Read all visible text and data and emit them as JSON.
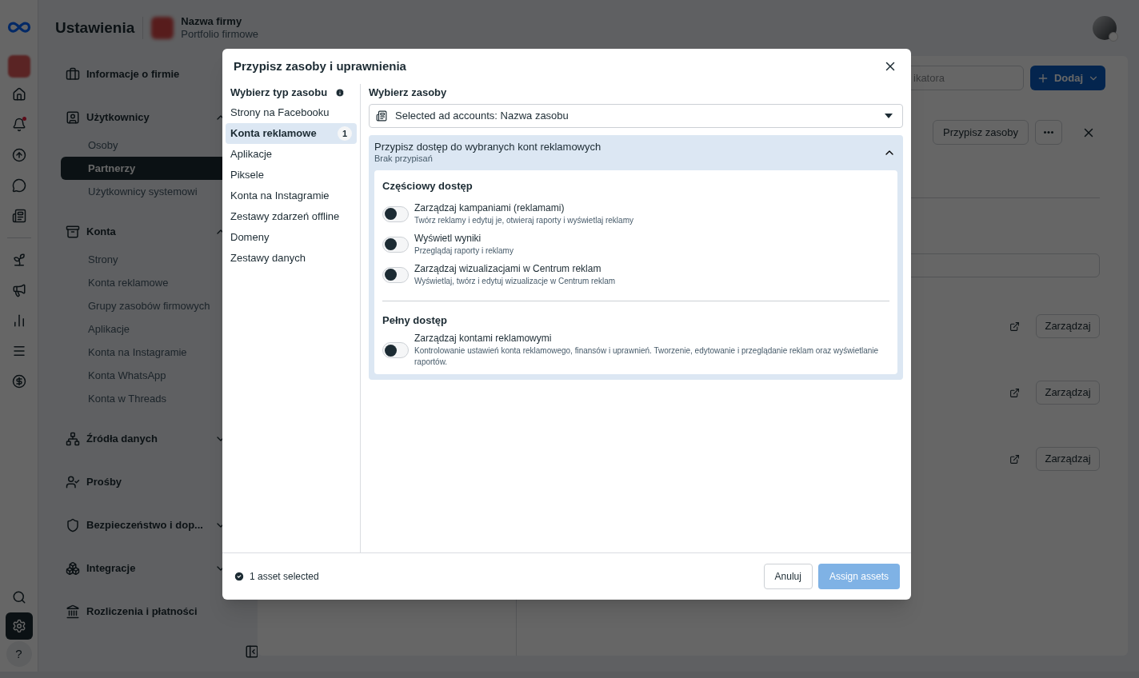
{
  "header": {
    "title": "Ustawienia",
    "business_name": "Nazwa firmy",
    "business_subtitle": "Portfolio firmowe"
  },
  "rail": {
    "top": [
      {
        "kind": "business",
        "selected": false
      },
      {
        "kind": "home",
        "selected": false
      },
      {
        "kind": "bell",
        "selected": false,
        "notification": true
      },
      {
        "kind": "navigation",
        "selected": false
      },
      {
        "kind": "chat",
        "selected": false
      },
      {
        "kind": "news",
        "selected": false
      }
    ],
    "middle": [
      {
        "kind": "sprout",
        "selected": false
      },
      {
        "kind": "megaphone",
        "selected": false
      },
      {
        "kind": "chart",
        "selected": false
      },
      {
        "kind": "menu",
        "selected": false
      },
      {
        "kind": "dollar",
        "selected": false
      }
    ],
    "bottom": [
      {
        "kind": "search",
        "selected": false
      },
      {
        "kind": "settings",
        "selected": true
      },
      {
        "kind": "help",
        "selected": false,
        "glyph": "?"
      }
    ]
  },
  "sidebar": {
    "sections": [
      {
        "kind": "link",
        "label": "Informacje o firmie"
      },
      {
        "kind": "group",
        "label": "Użytkownicy",
        "expanded": true,
        "items": [
          {
            "label": "Osoby",
            "selected": false
          },
          {
            "label": "Partnerzy",
            "selected": true
          },
          {
            "label": "Użytkownicy systemowi",
            "selected": false
          }
        ]
      },
      {
        "kind": "group",
        "label": "Konta",
        "expanded": true,
        "items": [
          {
            "label": "Strony",
            "selected": false
          },
          {
            "label": "Konta reklamowe",
            "selected": false
          },
          {
            "label": "Grupy zasobów firmowych",
            "selected": false
          },
          {
            "label": "Aplikacje",
            "selected": false
          },
          {
            "label": "Konta na Instagramie",
            "selected": false
          },
          {
            "label": "Konta WhatsApp",
            "selected": false
          },
          {
            "label": "Konta w Threads",
            "selected": false
          }
        ]
      },
      {
        "kind": "group",
        "label": "Źródła danych",
        "expanded": false
      },
      {
        "kind": "link",
        "label": "Prośby"
      },
      {
        "kind": "group",
        "label": "Bezpieczeństwo i dop...",
        "expanded": false
      },
      {
        "kind": "group",
        "label": "Integracje",
        "expanded": false
      },
      {
        "kind": "link",
        "label": "Rozliczenia i płatności"
      }
    ]
  },
  "main": {
    "search": {
      "placeholder": "ikatora"
    },
    "add_button": "Dodaj",
    "assign_button": "Przypisz zasoby",
    "rows": [
      {
        "action": "Zarządzaj"
      },
      {
        "action": "Zarządzaj"
      },
      {
        "action": "Zarządzaj"
      }
    ]
  },
  "dialog": {
    "title": "Przypisz zasoby i uprawnienia",
    "types_heading": "Wybierz typ zasobu",
    "asset_types": [
      {
        "label": "Strony na Facebooku",
        "selected": false
      },
      {
        "label": "Konta reklamowe",
        "selected": true,
        "count": "1"
      },
      {
        "label": "Aplikacje",
        "selected": false
      },
      {
        "label": "Piksele",
        "selected": false
      },
      {
        "label": "Konta na Instagramie",
        "selected": false
      },
      {
        "label": "Zestawy zdarzeń offline",
        "selected": false
      },
      {
        "label": "Domeny",
        "selected": false
      },
      {
        "label": "Zestawy danych",
        "selected": false
      }
    ],
    "assets_heading": "Wybierz zasoby",
    "asset_select": {
      "value": "Selected ad accounts: Nazwa zasobu"
    },
    "access": {
      "title": "Przypisz dostęp do wybranych kont reklamowych",
      "subtitle": "Brak przypisań",
      "expanded": true,
      "groups": [
        {
          "heading": "Częściowy dostęp",
          "permissions": [
            {
              "label": "Zarządzaj kampaniami (reklamami)",
              "description": "Twórz reklamy i edytuj je, otwieraj raporty i wyświetlaj reklamy",
              "on": false
            },
            {
              "label": "Wyświetl wyniki",
              "description": "Przeglądaj raporty i reklamy",
              "on": false
            },
            {
              "label": "Zarządzaj wizualizacjami w Centrum reklam",
              "description": "Wyświetlaj, twórz i edytuj wizualizacje w Centrum reklam",
              "on": false
            }
          ]
        },
        {
          "heading": "Pełny dostęp",
          "permissions": [
            {
              "label": "Zarządzaj kontami reklamowymi",
              "description": "Kontrolowanie ustawień konta reklamowego, finansów i uprawnień. Tworzenie, edytowanie i przeglądanie reklam oraz wyświetlanie raportów.",
              "on": false
            }
          ]
        }
      ]
    },
    "footer": {
      "selected_text": "1 asset selected",
      "cancel": "Anuluj",
      "submit": {
        "label": "Assign assets",
        "disabled": true
      }
    }
  }
}
